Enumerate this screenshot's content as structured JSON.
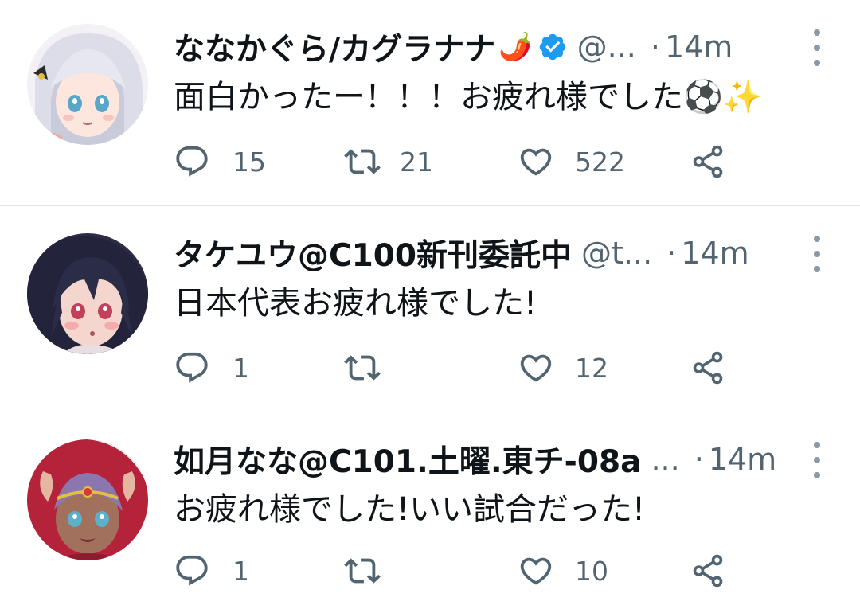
{
  "colors": {
    "text": "#0f1419",
    "secondary": "#536471",
    "verified": "#1d9bf0",
    "divider": "#e2e5e8"
  },
  "tweets": [
    {
      "display_name": "ななかぐら/カグラナナ",
      "name_emoji": "🌶️",
      "verified": true,
      "handle": "@...",
      "separator": "·",
      "time": "14m",
      "text": "面白かったー！！！お疲れ様でした⚽✨",
      "replies": "15",
      "retweets": "21",
      "likes": "522"
    },
    {
      "display_name": "タケユウ@C100新刊委託中",
      "verified": false,
      "handle": "@t...",
      "separator": "·",
      "time": "14m",
      "text": "日本代表お疲れ様でした!",
      "replies": "1",
      "retweets": "",
      "likes": "12"
    },
    {
      "display_name": "如月なな@C101.土曜.東チ-08a",
      "verified": false,
      "handle": "...",
      "separator": "·",
      "time": "14m",
      "text": "お疲れ様でした!いい試合だった!",
      "replies": "1",
      "retweets": "",
      "likes": "10"
    }
  ],
  "icons": {
    "reply": "reply-icon",
    "retweet": "retweet-icon",
    "like": "like-icon",
    "share": "share-icon",
    "more": "more-icon",
    "verified": "verified-badge-icon"
  }
}
